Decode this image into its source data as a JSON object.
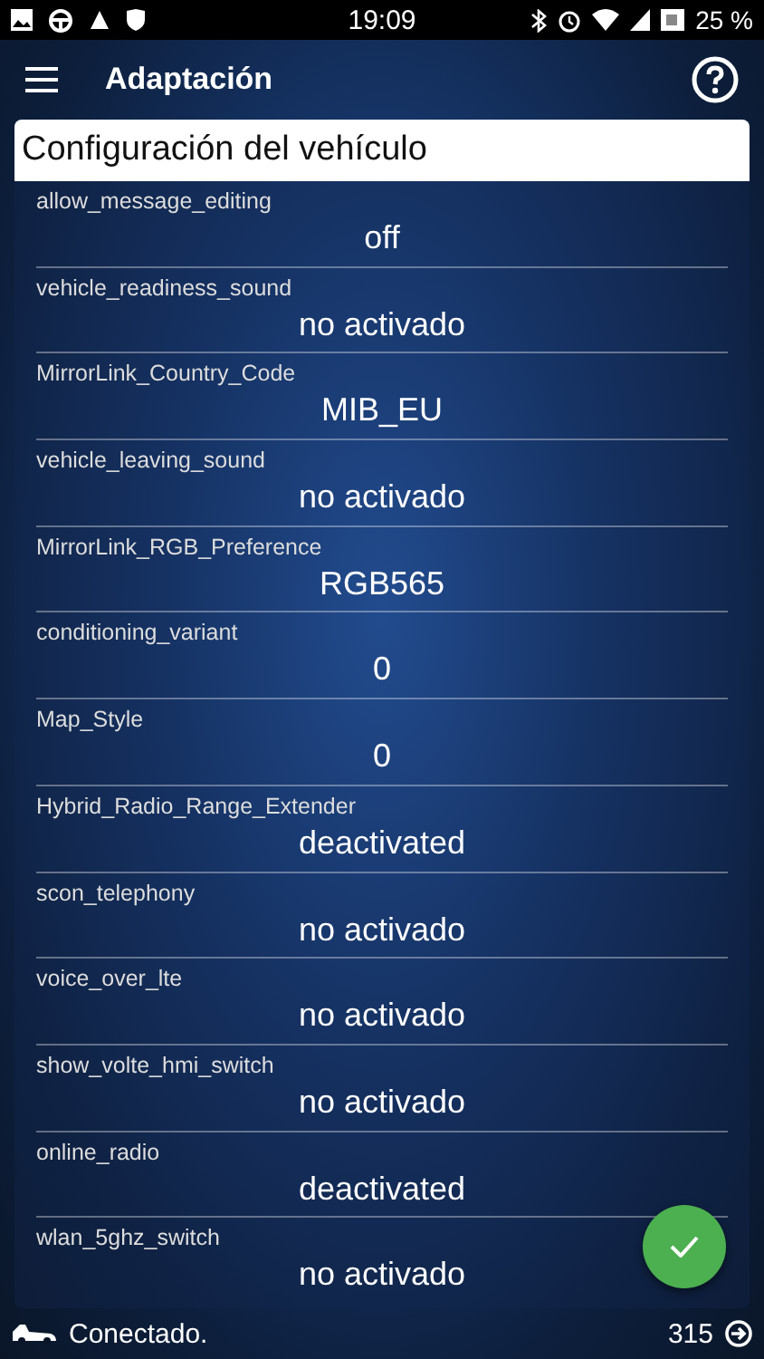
{
  "status_bar": {
    "time": "19:09",
    "battery": "25 %"
  },
  "app_bar": {
    "title": "Adaptación"
  },
  "card": {
    "title": "Configuración del vehículo",
    "settings": [
      {
        "name": "allow_message_editing",
        "value": "off"
      },
      {
        "name": "vehicle_readiness_sound",
        "value": "no activado"
      },
      {
        "name": "MirrorLink_Country_Code",
        "value": "MIB_EU"
      },
      {
        "name": "vehicle_leaving_sound",
        "value": "no activado"
      },
      {
        "name": "MirrorLink_RGB_Preference",
        "value": "RGB565"
      },
      {
        "name": "conditioning_variant",
        "value": "0"
      },
      {
        "name": "Map_Style",
        "value": "0"
      },
      {
        "name": "Hybrid_Radio_Range_Extender",
        "value": "deactivated"
      },
      {
        "name": "scon_telephony",
        "value": "no activado"
      },
      {
        "name": "voice_over_lte",
        "value": "no activado"
      },
      {
        "name": "show_volte_hmi_switch",
        "value": "no activado"
      },
      {
        "name": "online_radio",
        "value": "deactivated"
      },
      {
        "name": "wlan_5ghz_switch",
        "value": "no activado"
      }
    ]
  },
  "footer": {
    "status": "Conectado.",
    "count": "315"
  }
}
